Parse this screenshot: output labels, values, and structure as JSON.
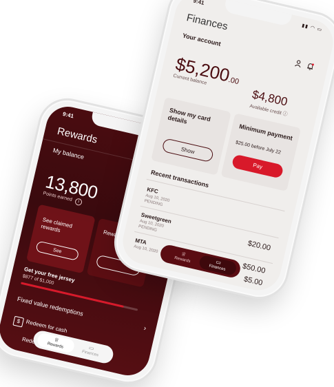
{
  "left_phone": {
    "time": "9:41",
    "title": "Rewards",
    "balance_label": "My balance",
    "points": "13,800",
    "points_label": "Points earned",
    "card_claimed": {
      "label": "See claimed rewards",
      "button": "See"
    },
    "card_info": {
      "label": "Rewards information"
    },
    "jersey": {
      "title": "Get your free jersey",
      "amount": "$877 of $1,000",
      "progress": 0.877
    },
    "fixed_title": "Fixed value redemptions",
    "items": [
      "Redeem for cash",
      "Redeem for travel"
    ],
    "nav": {
      "rewards": "Rewards",
      "finances": "Finances"
    },
    "colors": {
      "background": "#3a0a0e",
      "accent": "#d8192a"
    }
  },
  "right_phone": {
    "time": "9:41",
    "title": "Finances",
    "subtitle": "Your account",
    "balance": {
      "dollars": "$5,200",
      "cents": ".00",
      "label": "Current balance"
    },
    "credit": {
      "amount": "$4,800",
      "label": "Available credit"
    },
    "card_details": {
      "label": "Show my card details",
      "button": "Show"
    },
    "min_payment": {
      "label": "Minimum payment",
      "sub": "$25.00 before July 22",
      "button": "Pay"
    },
    "recent_title": "Recent transactions",
    "transactions": [
      {
        "name": "KFC",
        "date": "Aug 10, 2020",
        "status": "PENDING",
        "amount": ""
      },
      {
        "name": "Sweetgreen",
        "date": "Aug 10, 2020",
        "status": "PENDING",
        "amount": "$20.00"
      },
      {
        "name": "MTA",
        "date": "Aug 10, 2020",
        "status": "",
        "amount": "$50.00"
      },
      {
        "name": "",
        "date": "",
        "status": "",
        "amount": "$5.00"
      }
    ],
    "nav": {
      "rewards": "Rewards",
      "finances": "Finances"
    },
    "colors": {
      "accent": "#d8192a",
      "brand": "#4a0c10",
      "background": "#f0eeec"
    }
  }
}
